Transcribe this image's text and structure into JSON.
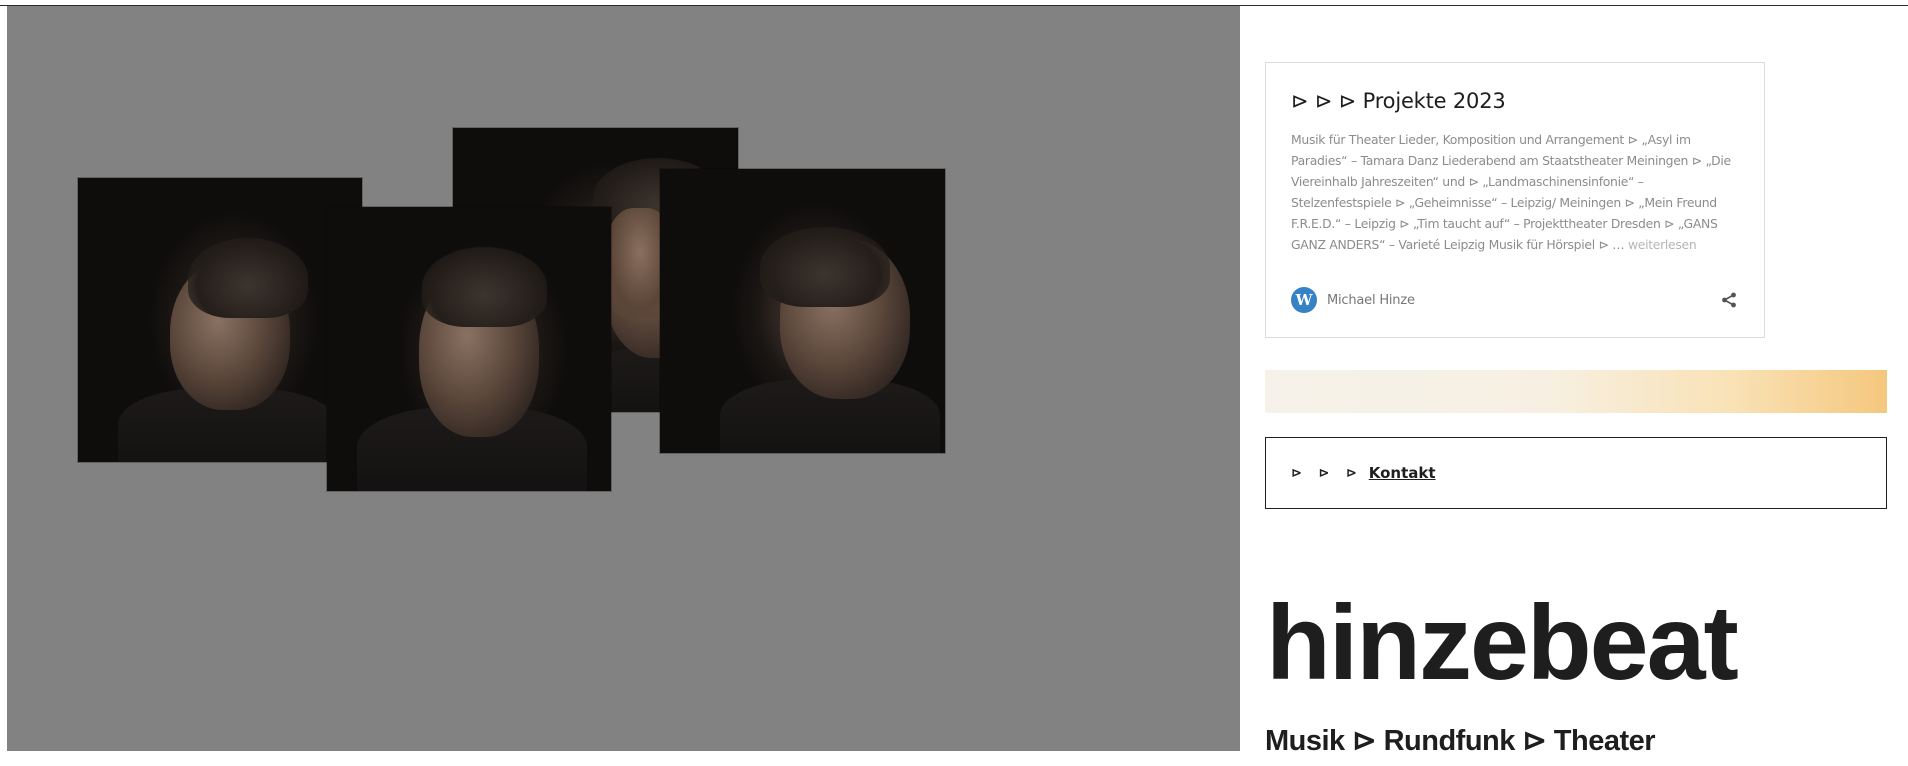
{
  "gallery": {
    "photos": [
      {
        "alt": ""
      },
      {
        "alt": ""
      },
      {
        "alt": ""
      },
      {
        "alt": ""
      }
    ]
  },
  "projects_card": {
    "title": "⊳ ⊳ ⊳ Projekte 2023",
    "body": "Musik für Theater Lieder, Komposition und Arrangement ⊳ „Asyl im Paradies“ – Tamara Danz     Liederabend am Staatstheater Meiningen ⊳ „Die Viereinhalb Jahreszeiten“ und ⊳ „Landmaschinensinfonie“ – Stelzenfestspiele ⊳ „Geheimnisse“ – Leipzig/ Meiningen ⊳ „Mein Freund F.R.E.D.“ – Leipzig ⊳ „Tim taucht auf“ – Projekttheater Dresden ⊳ „GANS GANZ ANDERS“ – Varieté Leipzig Musik für Hörspiel ⊳ …",
    "read_more": "weiterlesen",
    "author": "Michael Hinze",
    "author_icon": "wordpress-icon",
    "share_icon": "share-icon"
  },
  "contact": {
    "arrows": "⊳ ⊳ ⊳",
    "label": "Kontakt"
  },
  "site": {
    "title": "hinzebeat",
    "tagline": "Musik ⊳ Rundfunk ⊳ Theater"
  },
  "colors": {
    "gallery_bg": "#828282",
    "wordpress_blue": "#3582c4",
    "band_accent": "#f5c77e"
  }
}
